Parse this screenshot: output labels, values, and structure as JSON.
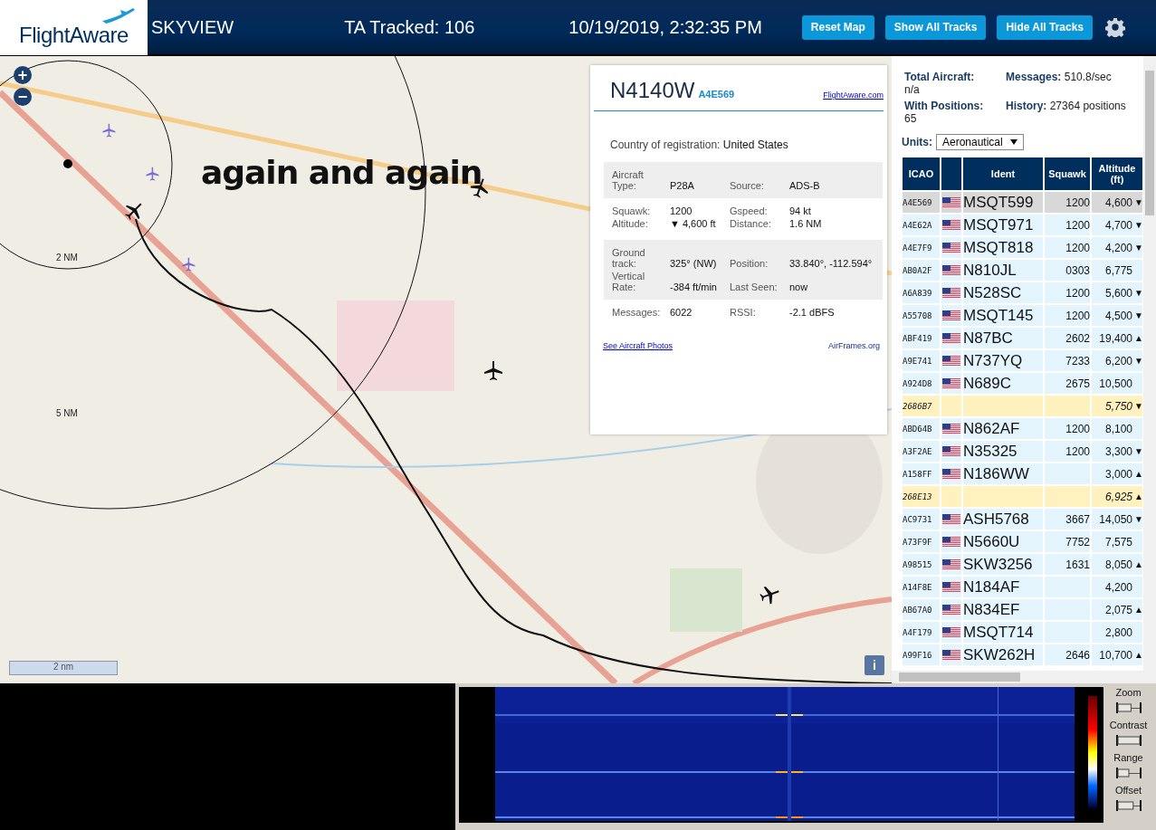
{
  "header": {
    "logo": "FlightAware",
    "title": "SKYVIEW",
    "tracked": "TA Tracked: 106",
    "datetime": "10/19/2019, 2:32:35 PM",
    "buttons": [
      "Reset Map",
      "Show All Tracks",
      "Hide All Tracks"
    ]
  },
  "map": {
    "annotation": "again and again",
    "rings": [
      "2 NM",
      "5 NM"
    ],
    "scale": "2 nm",
    "zoom_buttons": [
      "+",
      "−"
    ],
    "info_button": "i"
  },
  "popup": {
    "ident": "N4140W",
    "icao": "A4E569",
    "site_link": "FlightAware.com",
    "country_label": "Country of registration:",
    "country": "United States",
    "groups": [
      [
        {
          "label": "Aircraft Type:",
          "value": "P28A",
          "label2": "Source:",
          "value2": "ADS-B"
        }
      ],
      [
        {
          "label": "Squawk:",
          "value": "1200",
          "label2": "Gspeed:",
          "value2": "94 kt"
        },
        {
          "label": "Altitude:",
          "value": "▼ 4,600 ft",
          "label2": "Distance:",
          "value2": "1.6 NM"
        }
      ],
      [
        {
          "label": "Ground track:",
          "value": "325° (NW)",
          "label2": "Position:",
          "value2": "33.840°, -112.594°"
        },
        {
          "label": "Vertical Rate:",
          "value": "-384 ft/min",
          "label2": "Last Seen:",
          "value2": "now"
        }
      ],
      [
        {
          "label": "Messages:",
          "value": "6022",
          "label2": "RSSI:",
          "value2": "-2.1 dBFS"
        }
      ]
    ],
    "links": [
      "See Aircraft Photos",
      "AirFrames.org"
    ]
  },
  "stats": [
    {
      "label": "Total Aircraft:",
      "value": "n/a"
    },
    {
      "label": "Messages:",
      "value": "510.8/sec"
    },
    {
      "label": "With Positions:",
      "value": "65"
    },
    {
      "label": "History:",
      "value": "27364 positions"
    }
  ],
  "units": {
    "label": "Units:",
    "value": "Aeronautical"
  },
  "table": {
    "columns": [
      "ICAO",
      "",
      "Ident",
      "Squawk",
      "Altitude (ft)"
    ],
    "rows": [
      {
        "icao": "A4E569",
        "flag": true,
        "ident": "MSQT599",
        "squawk": "1200",
        "altitude": "4,600",
        "trend": "▼",
        "selected": true,
        "kind": "normal"
      },
      {
        "icao": "A4E62A",
        "flag": true,
        "ident": "MSQT971",
        "squawk": "1200",
        "altitude": "4,700",
        "trend": "▼",
        "selected": false,
        "kind": "normal"
      },
      {
        "icao": "A4E7F9",
        "flag": true,
        "ident": "MSQT818",
        "squawk": "1200",
        "altitude": "4,200",
        "trend": "▼",
        "selected": false,
        "kind": "normal"
      },
      {
        "icao": "AB0A2F",
        "flag": true,
        "ident": "N810JL",
        "squawk": "0303",
        "altitude": "6,775",
        "selected": false,
        "kind": "normal"
      },
      {
        "icao": "A6A839",
        "flag": true,
        "ident": "N528SC",
        "squawk": "1200",
        "altitude": "5,600",
        "trend": "▼",
        "selected": false,
        "kind": "normal"
      },
      {
        "icao": "A55708",
        "flag": true,
        "ident": "MSQT145",
        "squawk": "1200",
        "altitude": "4,500",
        "trend": "▼",
        "selected": false,
        "kind": "normal"
      },
      {
        "icao": "ABF419",
        "flag": true,
        "ident": "N87BC",
        "squawk": "2602",
        "altitude": "19,400",
        "trend": "▲",
        "selected": false,
        "kind": "normal"
      },
      {
        "icao": "A9E741",
        "flag": true,
        "ident": "N737YQ",
        "squawk": "7233",
        "altitude": "6,200",
        "trend": "▼",
        "selected": false,
        "kind": "normal"
      },
      {
        "icao": "A924D8",
        "flag": true,
        "ident": "N689C",
        "squawk": "2675",
        "altitude": "10,500",
        "selected": false,
        "kind": "normal"
      },
      {
        "icao": "2686B7",
        "flag": false,
        "altitude": "5,750",
        "trend": "▼",
        "selected": false,
        "kind": "noposition"
      },
      {
        "icao": "ABD64B",
        "flag": true,
        "ident": "N862AF",
        "squawk": "1200",
        "altitude": "8,100",
        "selected": false,
        "kind": "normal"
      },
      {
        "icao": "A3F2AE",
        "flag": true,
        "ident": "N35325",
        "squawk": "1200",
        "altitude": "3,300",
        "trend": "▼",
        "selected": false,
        "kind": "normal"
      },
      {
        "icao": "A158FF",
        "flag": true,
        "ident": "N186WW",
        "altitude": "3,000",
        "trend": "▲",
        "selected": false,
        "kind": "normal"
      },
      {
        "icao": "268E13",
        "flag": false,
        "altitude": "6,925",
        "trend": "▲",
        "selected": false,
        "kind": "noposition"
      },
      {
        "icao": "AC9731",
        "flag": true,
        "ident": "ASH5768",
        "squawk": "3667",
        "altitude": "14,050",
        "trend": "▼",
        "selected": false,
        "kind": "normal"
      },
      {
        "icao": "A73F9F",
        "flag": true,
        "ident": "N5660U",
        "squawk": "7752",
        "altitude": "7,575",
        "selected": false,
        "kind": "normal"
      },
      {
        "icao": "A98515",
        "flag": true,
        "ident": "SKW3256",
        "squawk": "1631",
        "altitude": "8,050",
        "trend": "▲",
        "selected": false,
        "kind": "normal"
      },
      {
        "icao": "A14F8E",
        "flag": true,
        "ident": "N184AF",
        "altitude": "4,200",
        "selected": false,
        "kind": "normal"
      },
      {
        "icao": "AB67A0",
        "flag": true,
        "ident": "N834EF",
        "altitude": "2,075",
        "trend": "▲",
        "selected": false,
        "kind": "normal"
      },
      {
        "icao": "A4F179",
        "flag": true,
        "ident": "MSQT714",
        "altitude": "2,800",
        "selected": false,
        "kind": "normal"
      },
      {
        "icao": "A99F16",
        "flag": true,
        "ident": "SKW262H",
        "squawk": "2646",
        "altitude": "10,700",
        "trend": "▲",
        "selected": false,
        "kind": "normal"
      }
    ]
  },
  "waterfall": {
    "sliders": [
      {
        "label": "Zoom",
        "level": 0.6
      },
      {
        "label": "Contrast",
        "level": 1
      },
      {
        "label": "Range",
        "level": 0.5
      },
      {
        "label": "Offset",
        "level": 0.7
      }
    ]
  }
}
